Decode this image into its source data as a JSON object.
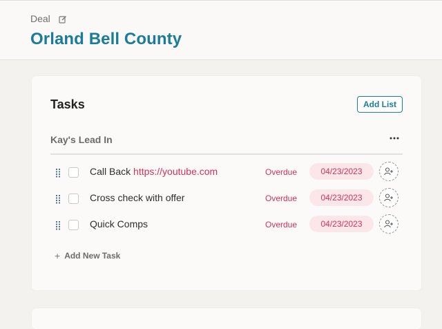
{
  "header": {
    "breadcrumb": "Deal",
    "title": "Orland Bell County",
    "edit_icon": "pencil-square-icon"
  },
  "tasks_panel": {
    "title": "Tasks",
    "add_list_label": "Add List",
    "list": {
      "name": "Kay's Lead In",
      "more_icon": "ellipsis-icon",
      "tasks": [
        {
          "label": "Call Back",
          "link": "https://youtube.com",
          "status": "Overdue",
          "due_date": "04/23/2023"
        },
        {
          "label": "Cross check with offer",
          "link": "",
          "status": "Overdue",
          "due_date": "04/23/2023"
        },
        {
          "label": "Quick Comps",
          "link": "",
          "status": "Overdue",
          "due_date": "04/23/2023"
        }
      ]
    },
    "add_task_label": "Add New Task"
  },
  "colors": {
    "accent": "#1a7c98",
    "overdue": "#d6315a",
    "date_chip_bg": "#fbe6ea"
  }
}
